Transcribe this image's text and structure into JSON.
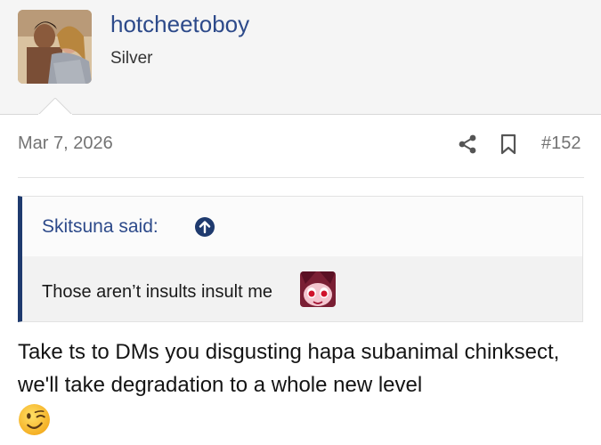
{
  "user": {
    "name": "hotcheetoboy",
    "title": "Silver",
    "avatar": "avatar-photo"
  },
  "post": {
    "date": "Mar 7, 2026",
    "number": "#152",
    "icons": {
      "share": "share-icon",
      "bookmark": "bookmark-icon"
    }
  },
  "quote": {
    "author": "Skitsuna said:",
    "jump_icon": "arrow-up-circle-icon",
    "text": "Those aren’t insults insult me",
    "sticker": "anime-sticker"
  },
  "body": {
    "text": "Take ts to DMs you disgusting hapa subanimal chinksect, we'll take degradation to a whole new level",
    "emoji": "winking-face-emoji"
  },
  "colors": {
    "accent": "#2d4a8a",
    "quote_border": "#1e3a6e",
    "muted": "#737373",
    "header_bg": "#f5f5f5"
  }
}
